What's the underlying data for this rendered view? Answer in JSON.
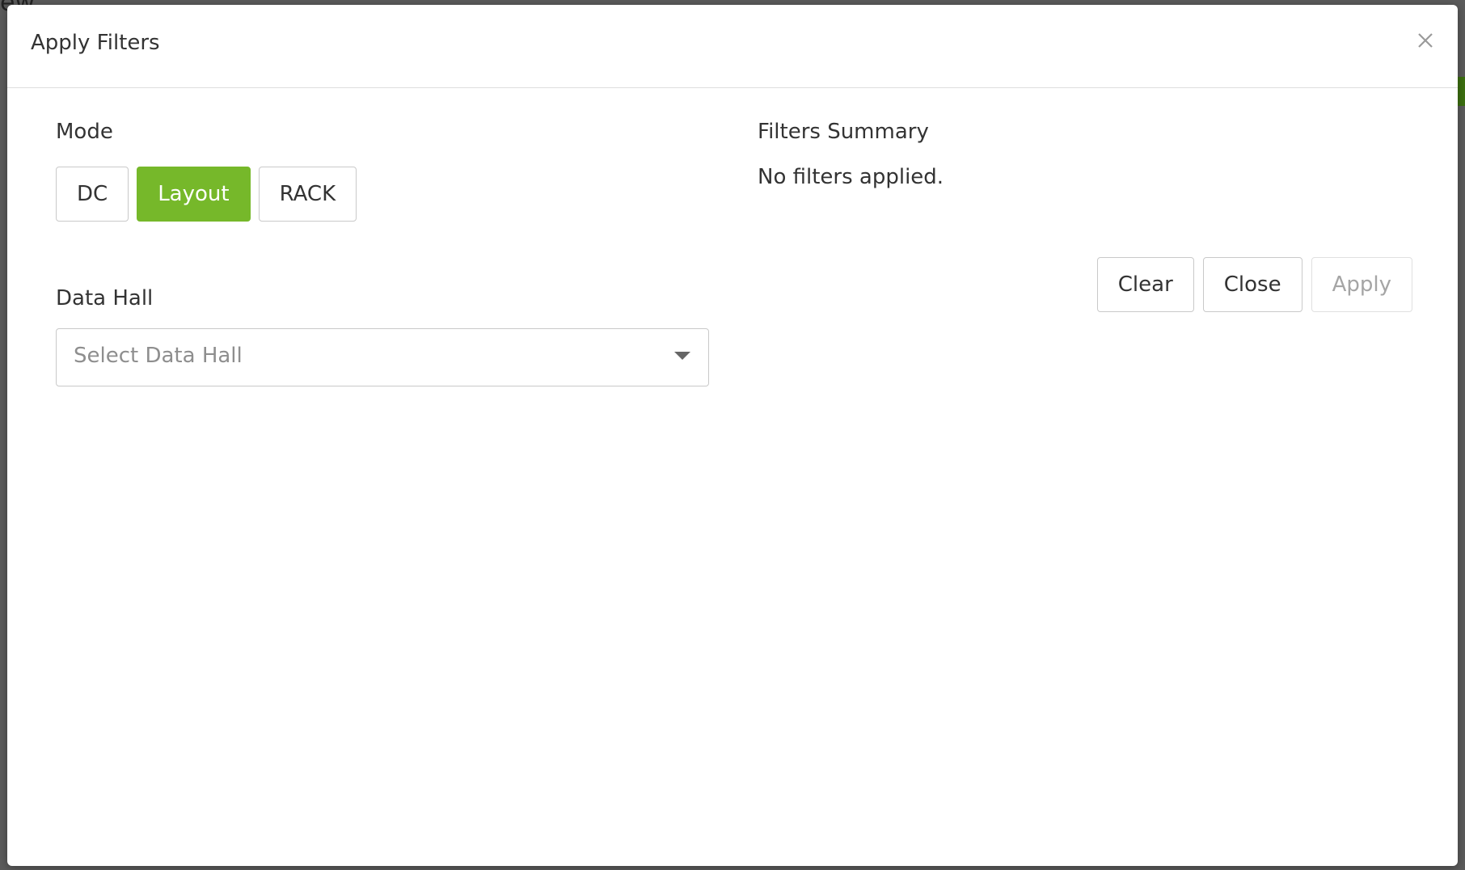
{
  "backdrop": {
    "partial_text": "ew"
  },
  "modal": {
    "title": "Apply Filters",
    "close_icon": "close-icon"
  },
  "mode": {
    "label": "Mode",
    "options": [
      {
        "label": "DC",
        "active": false
      },
      {
        "label": "Layout",
        "active": true
      },
      {
        "label": "RACK",
        "active": false
      }
    ]
  },
  "data_hall": {
    "label": "Data Hall",
    "placeholder": "Select Data Hall",
    "caret_icon": "chevron-down-icon"
  },
  "summary": {
    "label": "Filters Summary",
    "text": "No filters applied."
  },
  "actions": {
    "clear_label": "Clear",
    "close_label": "Close",
    "apply_label": "Apply",
    "apply_disabled": true
  },
  "colors": {
    "accent": "#76b82a",
    "border": "#c9c9c9",
    "placeholder": "#8e8e8e",
    "text": "#333333"
  }
}
